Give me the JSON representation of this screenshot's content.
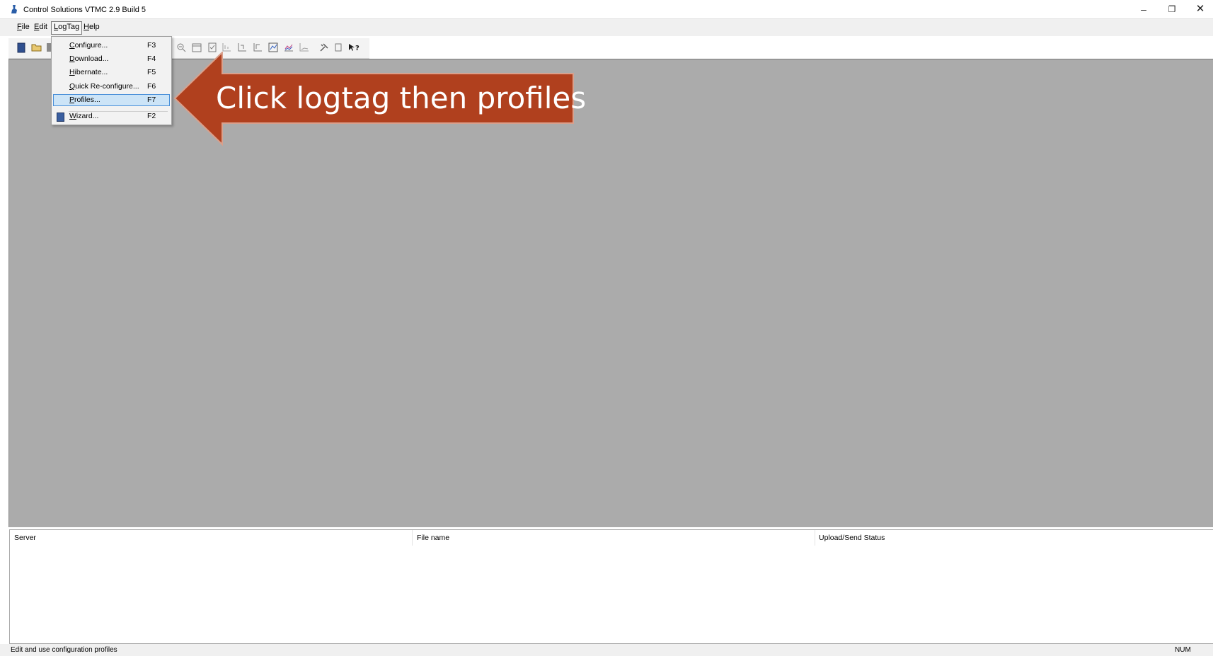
{
  "window": {
    "title": "Control Solutions VTMC 2.9 Build 5",
    "minimize": "–",
    "maximize": "❐",
    "close": "✕"
  },
  "menubar": {
    "items": [
      {
        "label": "File",
        "accesskey": "F"
      },
      {
        "label": "Edit",
        "accesskey": "E"
      },
      {
        "label": "LogTag",
        "accesskey": "L"
      },
      {
        "label": "Help",
        "accesskey": "H"
      }
    ]
  },
  "logtag_menu": {
    "items": [
      {
        "label": "Configure...",
        "shortcut": "F3"
      },
      {
        "label": "Download...",
        "shortcut": "F4"
      },
      {
        "label": "Hibernate...",
        "shortcut": "F5"
      },
      {
        "label": "Quick Re-configure...",
        "shortcut": "F6"
      },
      {
        "label": "Profiles...",
        "shortcut": "F7",
        "selected": true
      },
      {
        "label": "Wizard...",
        "shortcut": "F2"
      }
    ]
  },
  "toolbar": {
    "icons": [
      "new-file-icon",
      "open-folder-icon",
      "save-icon",
      "zoom-out-icon",
      "calendar-icon",
      "report-icon",
      "axis-icon",
      "axis-adjust-icon",
      "axis-reset-icon",
      "chart-icon",
      "chart-line-icon",
      "chart-flat-icon",
      "tools-icon",
      "device-icon",
      "help-icon"
    ]
  },
  "callout": {
    "text": "Click logtag then profiles",
    "color": "#b0401e"
  },
  "upload_panel": {
    "columns": [
      "Server",
      "File name",
      "Upload/Send Status"
    ]
  },
  "statusbar": {
    "message": "Edit and use configuration profiles",
    "num_indicator": "NUM"
  }
}
